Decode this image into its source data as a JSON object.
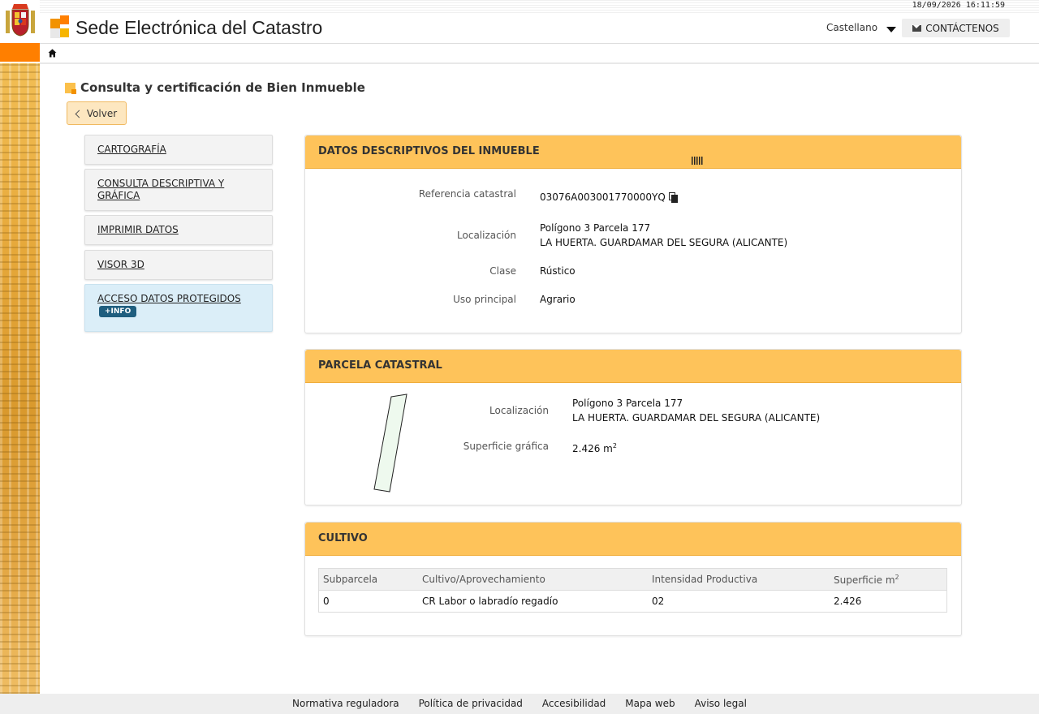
{
  "header": {
    "datetime": "18/09/2026 16:11:59",
    "site_title": "Sede Electrónica del Catastro",
    "language": "Castellano",
    "contact_label": "CONTÁCTENOS"
  },
  "page": {
    "title": "Consulta y certificación de Bien Inmueble",
    "back_label": "Volver"
  },
  "menu": {
    "items": [
      {
        "label": "CARTOGRAFÍA"
      },
      {
        "label": "CONSULTA DESCRIPTIVA Y GRÁFICA"
      },
      {
        "label": "IMPRIMIR DATOS"
      },
      {
        "label": "VISOR 3D"
      },
      {
        "label": "ACCESO DATOS PROTEGIDOS",
        "badge": "+INFO"
      }
    ]
  },
  "datos": {
    "heading": "DATOS DESCRIPTIVOS DEL INMUEBLE",
    "ref_label": "Referencia catastral",
    "ref_value": "03076A003001770000YQ",
    "loc_label": "Localización",
    "loc_line1": "Polígono 3 Parcela 177",
    "loc_line2": "LA HUERTA. GUARDAMAR DEL SEGURA (ALICANTE)",
    "clase_label": "Clase",
    "clase_value": "Rústico",
    "uso_label": "Uso principal",
    "uso_value": "Agrario"
  },
  "parcela": {
    "heading": "PARCELA CATASTRAL",
    "loc_label": "Localización",
    "loc_line1": "Polígono 3 Parcela 177",
    "loc_line2": "LA HUERTA. GUARDAMAR DEL SEGURA (ALICANTE)",
    "sup_label": "Superficie gráfica",
    "sup_value": "2.426 m",
    "sup_unit_sup": "2"
  },
  "cultivo": {
    "heading": "CULTIVO",
    "columns": [
      "Subparcela",
      "Cultivo/Aprovechamiento",
      "Intensidad Productiva",
      "Superficie m"
    ],
    "col_sup": "2",
    "rows": [
      [
        "0",
        "CR Labor o labradío regadío",
        "02",
        "2.426"
      ]
    ]
  },
  "footer": {
    "links": [
      "Normativa reguladora",
      "Política de privacidad",
      "Accesibilidad",
      "Mapa web",
      "Aviso legal"
    ]
  },
  "colors": {
    "accent_orange": "#ff7f00",
    "panel_header": "#fec35a",
    "badge": "#1f5e7f"
  }
}
